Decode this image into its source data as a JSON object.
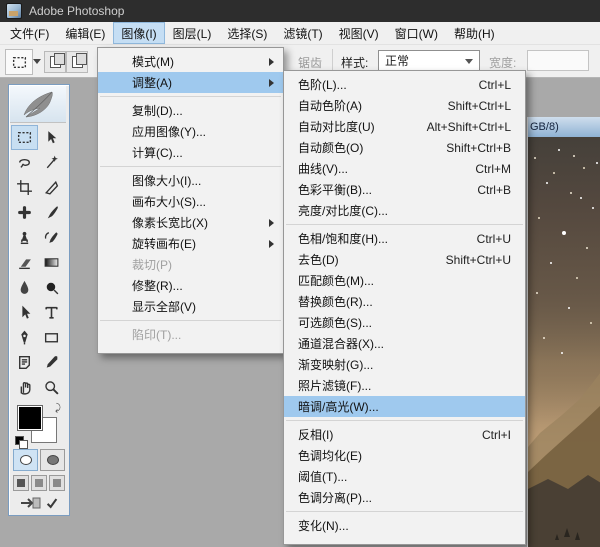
{
  "window": {
    "title": "Adobe Photoshop"
  },
  "menu_bar": {
    "items": [
      {
        "label": "文件(F)"
      },
      {
        "label": "编辑(E)"
      },
      {
        "label": "图像(I)",
        "active": true
      },
      {
        "label": "图层(L)"
      },
      {
        "label": "选择(S)"
      },
      {
        "label": "滤镜(T)"
      },
      {
        "label": "视图(V)"
      },
      {
        "label": "窗口(W)"
      },
      {
        "label": "帮助(H)"
      }
    ]
  },
  "options_bar": {
    "anti_alias_fragment": "锯齿",
    "style_label": "样式:",
    "style_value": "正常",
    "width_label": "宽度:",
    "width_value": ""
  },
  "image_menu": {
    "items": [
      {
        "label": "模式(M)",
        "submenu": true
      },
      {
        "label": "调整(A)",
        "submenu": true,
        "highlighted": true
      },
      {
        "type": "separator"
      },
      {
        "label": "复制(D)..."
      },
      {
        "label": "应用图像(Y)..."
      },
      {
        "label": "计算(C)..."
      },
      {
        "type": "separator"
      },
      {
        "label": "图像大小(I)..."
      },
      {
        "label": "画布大小(S)..."
      },
      {
        "label": "像素长宽比(X)",
        "submenu": true
      },
      {
        "label": "旋转画布(E)",
        "submenu": true
      },
      {
        "label": "裁切(P)",
        "disabled": true
      },
      {
        "label": "修整(R)..."
      },
      {
        "label": "显示全部(V)"
      },
      {
        "type": "separator"
      },
      {
        "label": "陷印(T)...",
        "disabled": true
      }
    ]
  },
  "adjust_submenu": {
    "items": [
      {
        "label": "色阶(L)...",
        "shortcut": "Ctrl+L"
      },
      {
        "label": "自动色阶(A)",
        "shortcut": "Shift+Ctrl+L"
      },
      {
        "label": "自动对比度(U)",
        "shortcut": "Alt+Shift+Ctrl+L"
      },
      {
        "label": "自动颜色(O)",
        "shortcut": "Shift+Ctrl+B"
      },
      {
        "label": "曲线(V)...",
        "shortcut": "Ctrl+M"
      },
      {
        "label": "色彩平衡(B)...",
        "shortcut": "Ctrl+B"
      },
      {
        "label": "亮度/对比度(C)..."
      },
      {
        "type": "separator"
      },
      {
        "label": "色相/饱和度(H)...",
        "shortcut": "Ctrl+U"
      },
      {
        "label": "去色(D)",
        "shortcut": "Shift+Ctrl+U"
      },
      {
        "label": "匹配颜色(M)..."
      },
      {
        "label": "替换颜色(R)..."
      },
      {
        "label": "可选颜色(S)..."
      },
      {
        "label": "通道混合器(X)..."
      },
      {
        "label": "渐变映射(G)..."
      },
      {
        "label": "照片滤镜(F)..."
      },
      {
        "label": "暗调/高光(W)...",
        "highlighted": true
      },
      {
        "type": "separator"
      },
      {
        "label": "反相(I)",
        "shortcut": "Ctrl+I"
      },
      {
        "label": "色调均化(E)"
      },
      {
        "label": "阈值(T)..."
      },
      {
        "label": "色调分离(P)..."
      },
      {
        "type": "separator"
      },
      {
        "label": "变化(N)..."
      }
    ]
  },
  "toolbox": {
    "tools": [
      {
        "icon": "rect-marquee",
        "selected": true
      },
      {
        "icon": "move"
      },
      {
        "icon": "lasso"
      },
      {
        "icon": "magic-wand"
      },
      {
        "icon": "crop"
      },
      {
        "icon": "slice"
      },
      {
        "icon": "healing-brush"
      },
      {
        "icon": "brush"
      },
      {
        "icon": "clone-stamp"
      },
      {
        "icon": "history-brush"
      },
      {
        "icon": "eraser"
      },
      {
        "icon": "gradient"
      },
      {
        "icon": "blur"
      },
      {
        "icon": "burn"
      },
      {
        "icon": "path-select"
      },
      {
        "icon": "type"
      },
      {
        "icon": "pen"
      },
      {
        "icon": "shape-rect"
      },
      {
        "icon": "notes"
      },
      {
        "icon": "eyedropper"
      },
      {
        "icon": "hand"
      },
      {
        "icon": "zoom"
      }
    ],
    "foreground_color": "#000000",
    "background_color": "#ffffff"
  },
  "document": {
    "title_fragment": "GB/8)"
  },
  "colors": {
    "titlebar_bg": "#2d2d2d",
    "menu_highlight": "#9fc9ee",
    "menubar_active": "#c5def4",
    "workspace": "#a9a9a9",
    "doc_titlebar": "#8fb2d4"
  }
}
